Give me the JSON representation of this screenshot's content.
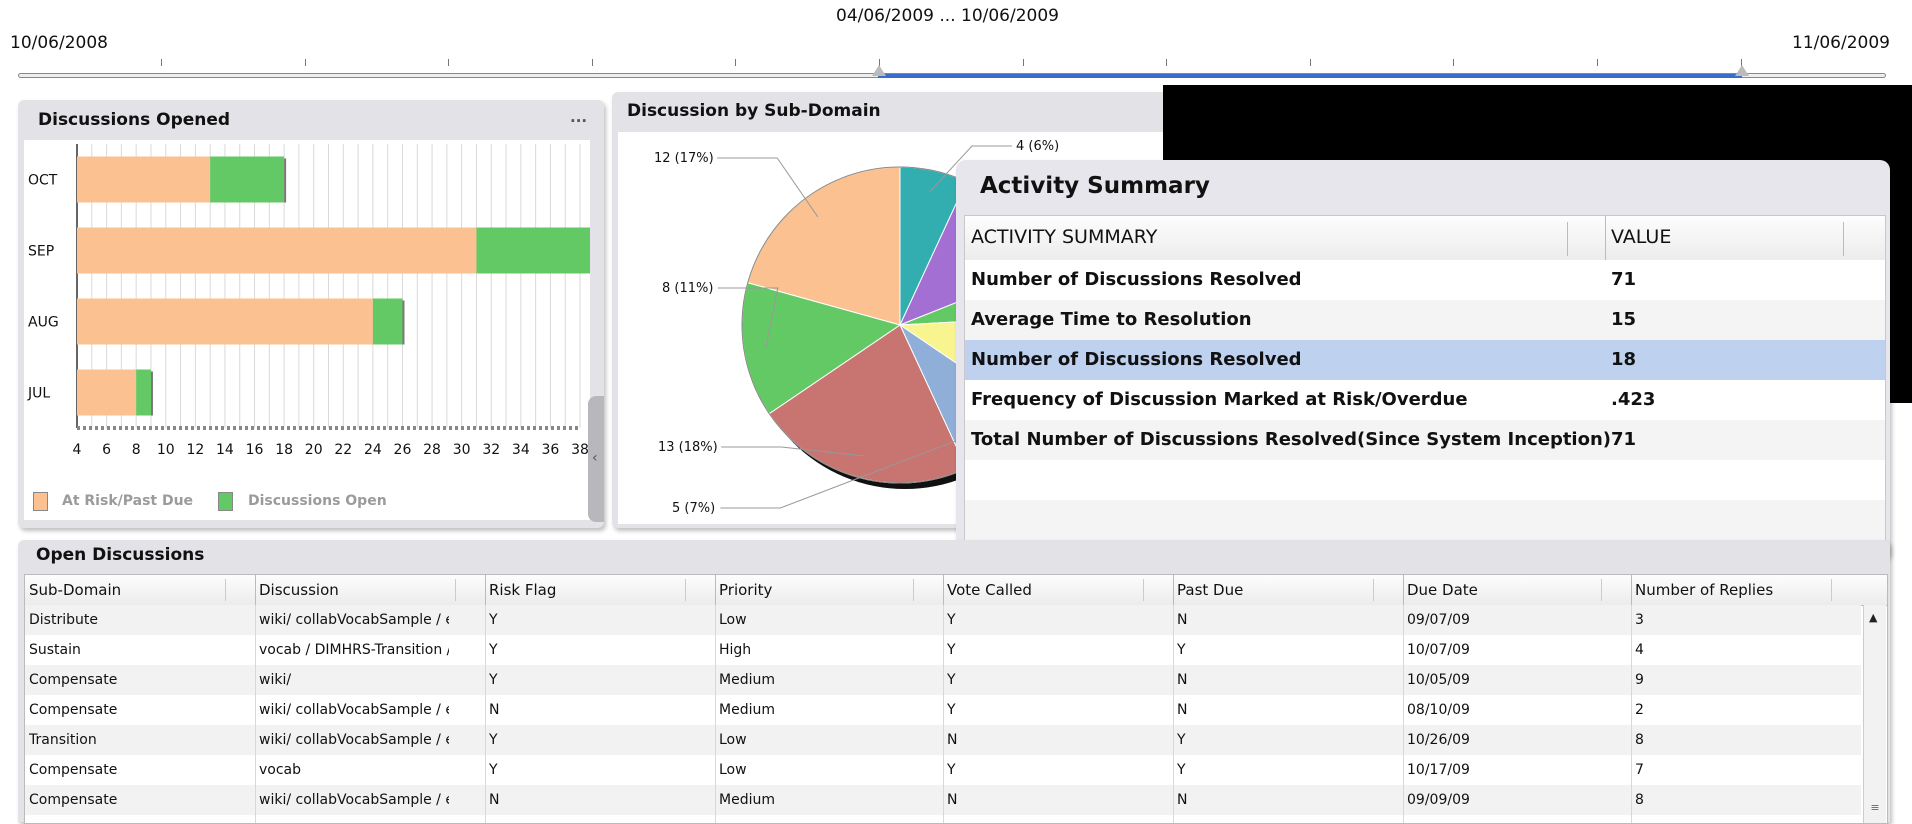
{
  "timeline": {
    "start": "10/06/2008",
    "end": "11/06/2009",
    "selection": "04/06/2009 ... 10/06/2009"
  },
  "discussions_opened": {
    "title": "Discussions Opened",
    "menu": "...",
    "legend": [
      "At Risk/Past Due",
      "Discussions Open"
    ]
  },
  "sub_domain": {
    "title": "Discussion by Sub-Domain",
    "labels": [
      "12 (17%)",
      "4 (6%)",
      "8 (11%)",
      "13 (18%)",
      "5 (7%)"
    ]
  },
  "activity_summary": {
    "title": "Activity Summary",
    "col_activity": "ACTIVITY SUMMARY",
    "col_value": "VALUE",
    "rows": [
      {
        "name": "Number of Discussions Resolved",
        "value": "71"
      },
      {
        "name": "Average Time to Resolution",
        "value": "15"
      },
      {
        "name": "Number of Discussions Resolved",
        "value": "18"
      },
      {
        "name": "Frequency of Discussion Marked at Risk/Overdue",
        "value": ".423"
      },
      {
        "name": "Total Number of Discussions Resolved(Since System Inception)",
        "value": "71"
      }
    ]
  },
  "open_discussions": {
    "title": "Open Discussions",
    "columns": [
      "Sub-Domain",
      "Discussion",
      "Risk Flag",
      "Priority",
      "Vote Called",
      "Past Due",
      "Due Date",
      "Number of Replies"
    ],
    "rows": [
      [
        "Distribute",
        "wiki/ collabVocabSample / entry",
        "Y",
        "Low",
        "Y",
        "N",
        "09/07/09",
        "3"
      ],
      [
        "Sustain",
        "vocab / DIMHRS-Transition / ent",
        "Y",
        "High",
        "Y",
        "Y",
        "10/07/09",
        "4"
      ],
      [
        "Compensate",
        "wiki/",
        "Y",
        "Medium",
        "Y",
        "N",
        "10/05/09",
        "9"
      ],
      [
        "Compensate",
        "wiki/ collabVocabSample / entry",
        "N",
        "Medium",
        "Y",
        "N",
        "08/10/09",
        "2"
      ],
      [
        "Transition",
        "wiki/ collabVocabSample / entry",
        "Y",
        "Low",
        "N",
        "Y",
        "10/26/09",
        "8"
      ],
      [
        "Compensate",
        "vocab",
        "Y",
        "Low",
        "Y",
        "Y",
        "10/17/09",
        "7"
      ],
      [
        "Compensate",
        "wiki/ collabVocabSample / entry",
        "N",
        "Medium",
        "N",
        "N",
        "09/09/09",
        "8"
      ]
    ]
  },
  "chart_data": [
    {
      "type": "bar",
      "orientation": "horizontal",
      "stacked": true,
      "title": "Discussions Opened",
      "categories": [
        "OCT",
        "SEP",
        "AUG",
        "JUL"
      ],
      "series": [
        {
          "name": "At Risk/Past Due",
          "values": [
            9,
            27,
            20,
            4
          ],
          "color": "#fbc190"
        },
        {
          "name": "Discussions Open",
          "values": [
            5,
            11,
            2,
            1
          ],
          "color": "#63c965"
        }
      ],
      "xlim": [
        4,
        38
      ],
      "xticks": [
        "4",
        "6",
        "8",
        "10",
        "12",
        "14",
        "16",
        "18",
        "20",
        "22",
        "24",
        "26",
        "28",
        "30",
        "32",
        "34",
        "36",
        "38"
      ],
      "grid": true,
      "legend": "bottom"
    },
    {
      "type": "pie",
      "title": "Discussion by Sub-Domain",
      "values": [
        12,
        4,
        7,
        3,
        6,
        5,
        13,
        8
      ],
      "colors": [
        "#fbc190",
        "#32aeb0",
        "#a36fd3",
        "#63c965",
        "#f8f48f",
        "#8fafd9",
        "#c87470",
        "#63c965"
      ],
      "labels": [
        "12 (17%)",
        "4 (6%)",
        "",
        "",
        "",
        "5 (7%)",
        "13 (18%)",
        "8 (11%)"
      ]
    }
  ]
}
